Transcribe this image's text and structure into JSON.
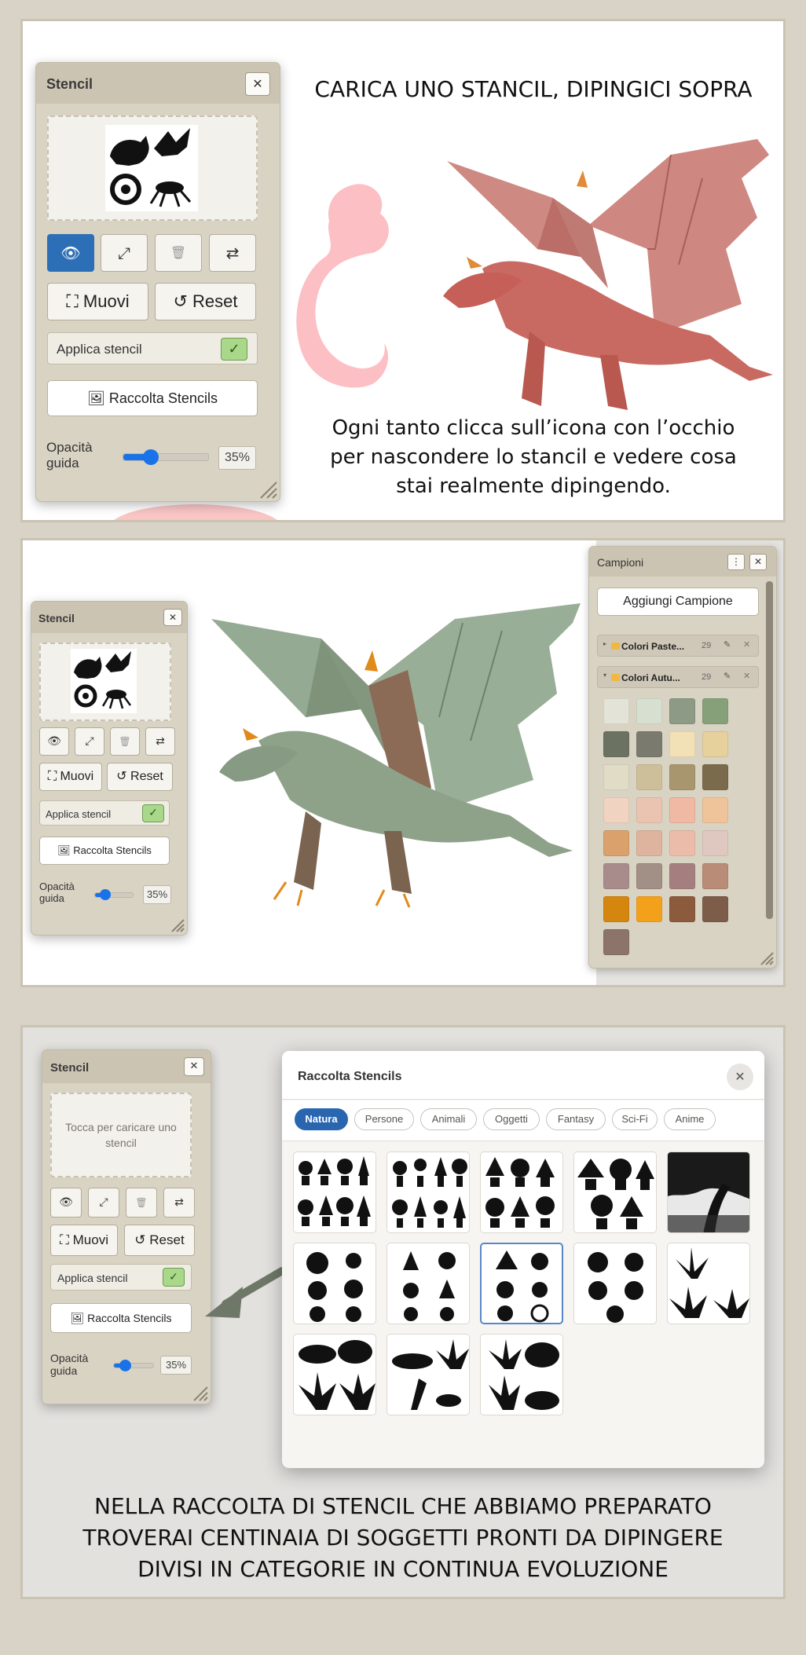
{
  "section1": {
    "headline": "CARICA UNO STANCIL, DIPINGICI SOPRA",
    "caption_lines": [
      "Ogni tanto clicca sull’icona con l’occhio",
      "per nascondere lo stancil e vedere cosa",
      "stai realmente dipingendo."
    ]
  },
  "stencil_panel": {
    "title": "Stencil",
    "close": "✕",
    "move_label": "⛶ Muovi",
    "reset_label": "↺ Reset",
    "apply_label": "Applica stencil",
    "apply_check": "✓",
    "collection_label": "🖼 Raccolta Stencils",
    "opacity_label": "Opacità guida",
    "opacity_value": "35%",
    "opacity_level": 0.35,
    "empty_preview_text": "Tocca per caricare uno stencil",
    "icons": [
      "eye-icon",
      "resize-icon",
      "trash-icon",
      "swap-icon"
    ],
    "toolbar_glyphs": [
      "👁",
      "⤢",
      "🗑",
      "⇄"
    ]
  },
  "campioni": {
    "title": "Campioni",
    "menu_glyph": "⋮",
    "close": "✕",
    "add_label": "Aggiungi Campione",
    "groups": [
      {
        "name": "Colori Paste...",
        "count": "29"
      },
      {
        "name": "Colori Autu...",
        "count": "29"
      }
    ],
    "swatches": [
      "#e3e3d7",
      "#d7e0d0",
      "#8c9a86",
      "#86a07a",
      "#6c7261",
      "#7b7a6e",
      "#f2e0b6",
      "#e6d09c",
      "#e1dcc6",
      "#cdbf9a",
      "#a8976e",
      "#7a6b4c",
      "#f1d3c1",
      "#eac4b1",
      "#efb9a3",
      "#f0c49a",
      "#daa16c",
      "#deb49e",
      "#ecbcaa",
      "#dfc8c0",
      "#a88c8c",
      "#a28f86",
      "#a57f7f",
      "#b88c76",
      "#d4860e",
      "#f3a11a",
      "#8c5a3c",
      "#7d5c4a",
      "#8c746a"
    ],
    "colors": {
      "accent": "#2d6fb7",
      "panel": "#d9d3c4",
      "check": "#a9d88a"
    }
  },
  "section3": {
    "headline_lines": [
      "NELLA RACCOLTA DI STENCIL CHE ABBIAMO PREPARATO",
      "TROVERAI CENTINAIA DI SOGGETTI PRONTI DA DIPINGERE",
      "DIVISI IN CATEGORIE IN CONTINUA EVOLUZIONE"
    ]
  },
  "raccolta": {
    "title": "Raccolta Stencils",
    "close": "✕",
    "tabs": [
      "Natura",
      "Persone",
      "Animali",
      "Oggetti",
      "Fantasy",
      "Sci-Fi",
      "Anime"
    ],
    "active_tab": "Natura"
  }
}
